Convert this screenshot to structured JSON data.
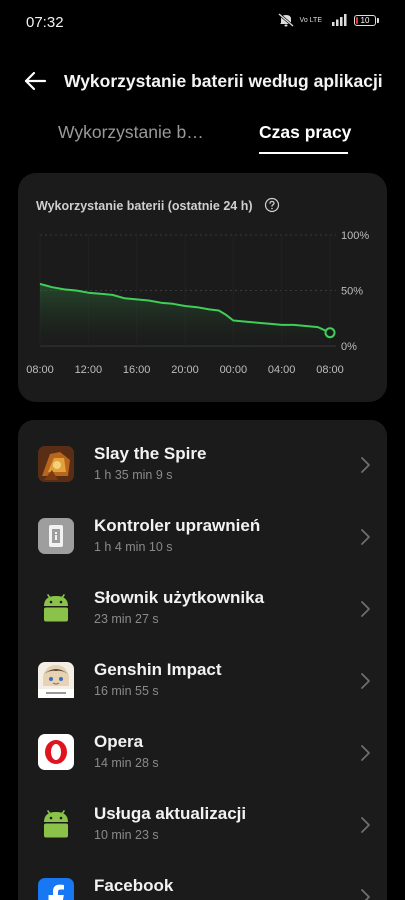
{
  "status_bar": {
    "time": "07:32",
    "icons": [
      "mute-icon",
      "volte-icon",
      "lte-signal-icon",
      "battery-icon"
    ],
    "volte_label": "Vo LTE",
    "lte_label": "LTE",
    "battery_percent": "10",
    "battery_level": 0.1,
    "battery_color": "#e53935"
  },
  "header": {
    "title": "Wykorzystanie baterii według aplikacji",
    "back_icon": "arrow-left-icon"
  },
  "tabs": [
    {
      "label": "Wykorzystanie b…",
      "active": false
    },
    {
      "label": "Czas pracy",
      "active": true
    }
  ],
  "chart_card": {
    "title": "Wykorzystanie baterii (ostatnie 24 h)",
    "help_icon": "question-circle-icon"
  },
  "chart_data": {
    "type": "area",
    "x_ticks": [
      "08:00",
      "12:00",
      "16:00",
      "20:00",
      "00:00",
      "04:00",
      "08:00"
    ],
    "y_ticks": [
      "0%",
      "50%",
      "100%"
    ],
    "ylim": [
      0,
      100
    ],
    "xlim": [
      0,
      24
    ],
    "series": [
      {
        "values": [
          [
            0,
            56
          ],
          [
            0.3,
            55
          ],
          [
            1,
            53
          ],
          [
            2,
            51
          ],
          [
            3,
            50
          ],
          [
            4,
            48
          ],
          [
            5,
            47
          ],
          [
            6,
            46
          ],
          [
            7,
            43
          ],
          [
            8,
            42
          ],
          [
            9,
            41
          ],
          [
            10,
            39
          ],
          [
            11,
            38
          ],
          [
            12,
            36
          ],
          [
            13,
            35
          ],
          [
            14,
            33
          ],
          [
            14.8,
            32
          ],
          [
            15.4,
            28
          ],
          [
            16,
            23
          ],
          [
            17,
            22
          ],
          [
            18,
            21
          ],
          [
            19,
            20
          ],
          [
            20,
            19
          ],
          [
            21,
            19
          ],
          [
            22,
            18
          ],
          [
            23,
            17
          ],
          [
            24,
            12
          ]
        ]
      }
    ],
    "line_color": "#3fcf58",
    "grid": true
  },
  "apps": [
    {
      "name": "Slay the Spire",
      "time": "1 h 35 min 9 s",
      "icon": "slay-the-spire-icon"
    },
    {
      "name": "Kontroler uprawnień",
      "time": "1 h 4 min 10 s",
      "icon": "permission-controller-icon"
    },
    {
      "name": "Słownik użytkownika",
      "time": "23 min 27 s",
      "icon": "android-icon"
    },
    {
      "name": "Genshin Impact",
      "time": "16 min 55 s",
      "icon": "genshin-impact-icon"
    },
    {
      "name": "Opera",
      "time": "14 min 28 s",
      "icon": "opera-icon"
    },
    {
      "name": "Usługa aktualizacji",
      "time": "10 min 23 s",
      "icon": "android-icon"
    },
    {
      "name": "Facebook",
      "time": "",
      "icon": "facebook-icon"
    }
  ],
  "colors": {
    "background": "#000000",
    "card": "#1b1b1b",
    "accent_green": "#3fcf58",
    "android_green": "#8bc34a",
    "opera_red": "#e0141e",
    "facebook_blue": "#1877f2"
  }
}
